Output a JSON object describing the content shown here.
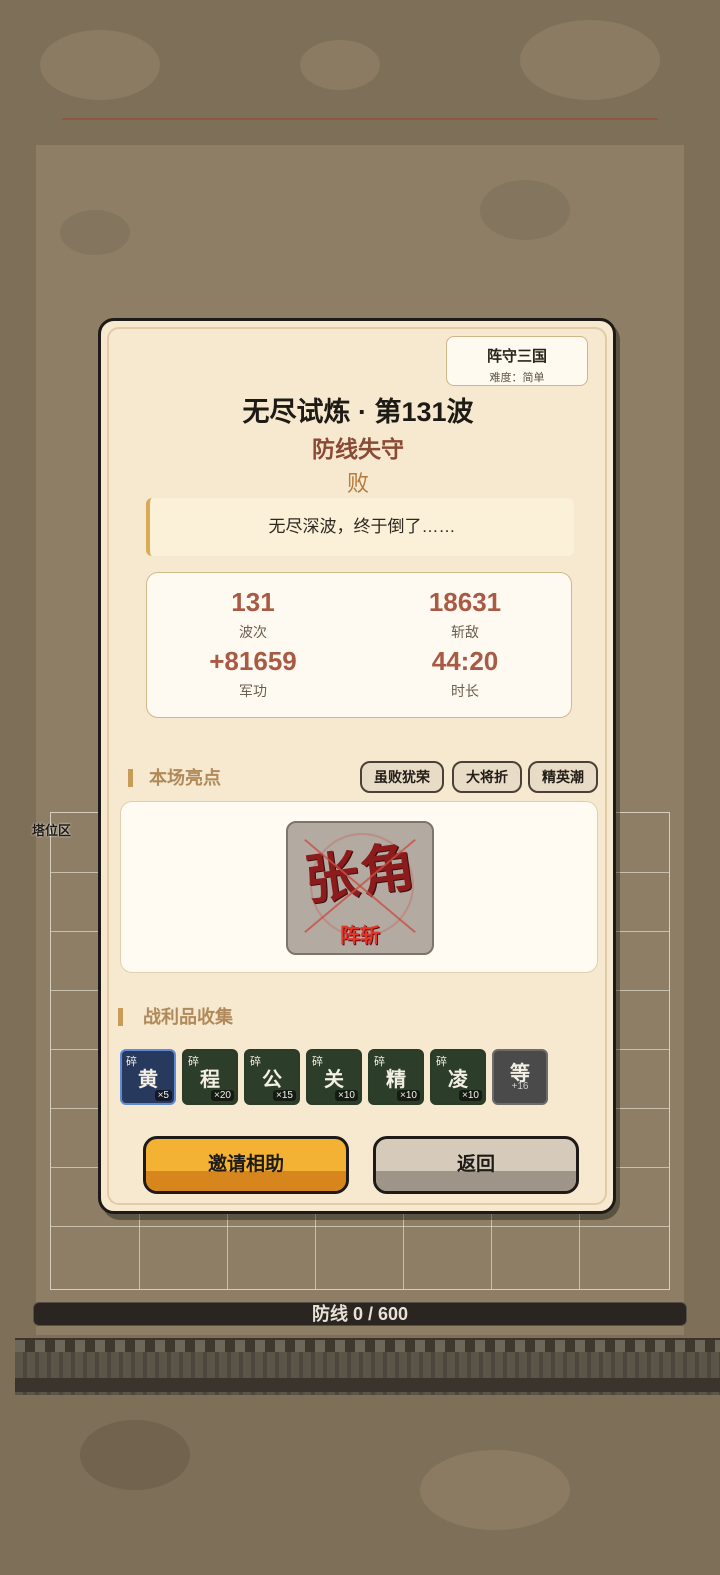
{
  "colors": {
    "accent": "#f3b233",
    "stat_value": "#a85a44",
    "subtitle": "#8a4a36"
  },
  "scene": {
    "zone_label": "塔位区",
    "defense_bar": "防线 0 / 600",
    "defense_progress": 0
  },
  "badge": {
    "title": "阵守三国",
    "difficulty": "难度：简单"
  },
  "title": "无尽试炼 · 第131波",
  "subtitle": "防线失守",
  "result": "败",
  "quote": "无尽深波，终于倒了……",
  "stats": [
    {
      "value": "131",
      "label": "波次"
    },
    {
      "value": "18631",
      "label": "斩敌"
    },
    {
      "value": "+81659",
      "label": "军功"
    },
    {
      "value": "44:20",
      "label": "时长"
    }
  ],
  "highlights": {
    "title": "本场亮点",
    "tags": [
      "虽败犹荣",
      "大将折",
      "精英潮"
    ],
    "portrait": {
      "name": "张角",
      "stamp": "阵斩"
    }
  },
  "loot": {
    "title": "战利品收集",
    "items": [
      {
        "char": "黄",
        "frag": "碎",
        "count": "×5"
      },
      {
        "char": "程",
        "frag": "碎",
        "count": "×20"
      },
      {
        "char": "公",
        "frag": "碎",
        "count": "×15"
      },
      {
        "char": "关",
        "frag": "碎",
        "count": "×10"
      },
      {
        "char": "精",
        "frag": "碎",
        "count": "×10"
      },
      {
        "char": "凌",
        "frag": "碎",
        "count": "×10"
      }
    ],
    "more": {
      "char": "等",
      "count": "+16"
    }
  },
  "buttons": {
    "invite": "邀请相助",
    "back": "返回"
  }
}
